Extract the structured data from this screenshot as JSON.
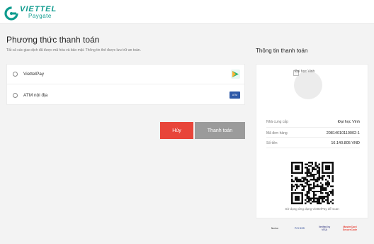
{
  "header": {
    "brand": "VIETTEL",
    "sub": "Paygate",
    "logo_icon": "viettel-logo-icon",
    "brand_color": "#0f9b8e"
  },
  "payment": {
    "title": "Phương thức thanh toán",
    "note": "Tất cả các giao dịch đã được mã hóa và bảo mật. Thông tin thẻ được lưu trữ an toàn.",
    "methods": [
      {
        "label": "ViettelPay",
        "icon": "viettelpay-icon"
      },
      {
        "label": "ATM nội địa",
        "icon": "atm-card-icon",
        "icon_text": "ATM"
      }
    ]
  },
  "actions": {
    "cancel_label": "Hủy",
    "cancel_color": "#e8453a",
    "pay_label": "Thanh toán",
    "pay_color": "#9b9b9b"
  },
  "info": {
    "title": "Thông tin thanh toán",
    "merchant_image_alt": "Đại học Vinh",
    "rows": [
      {
        "label": "Nhà cung cấp",
        "value": "Đại học Vinh"
      },
      {
        "label": "Mã đơn hàng",
        "value": "20814010110002-1"
      },
      {
        "label": "Số tiền",
        "value": "16.140.805 VND"
      }
    ],
    "qr_caption": "Sử dụng ứng dụng ViettelPay để scan"
  },
  "security_badges": [
    {
      "name": "norton-badge",
      "text": "Norton"
    },
    {
      "name": "pci-dss-badge",
      "text": "PCI DSS"
    },
    {
      "name": "verified-by-visa-badge",
      "text": "Verified by VISA"
    },
    {
      "name": "mastercard-securecode-badge",
      "text": "MasterCard SecureCode"
    }
  ]
}
